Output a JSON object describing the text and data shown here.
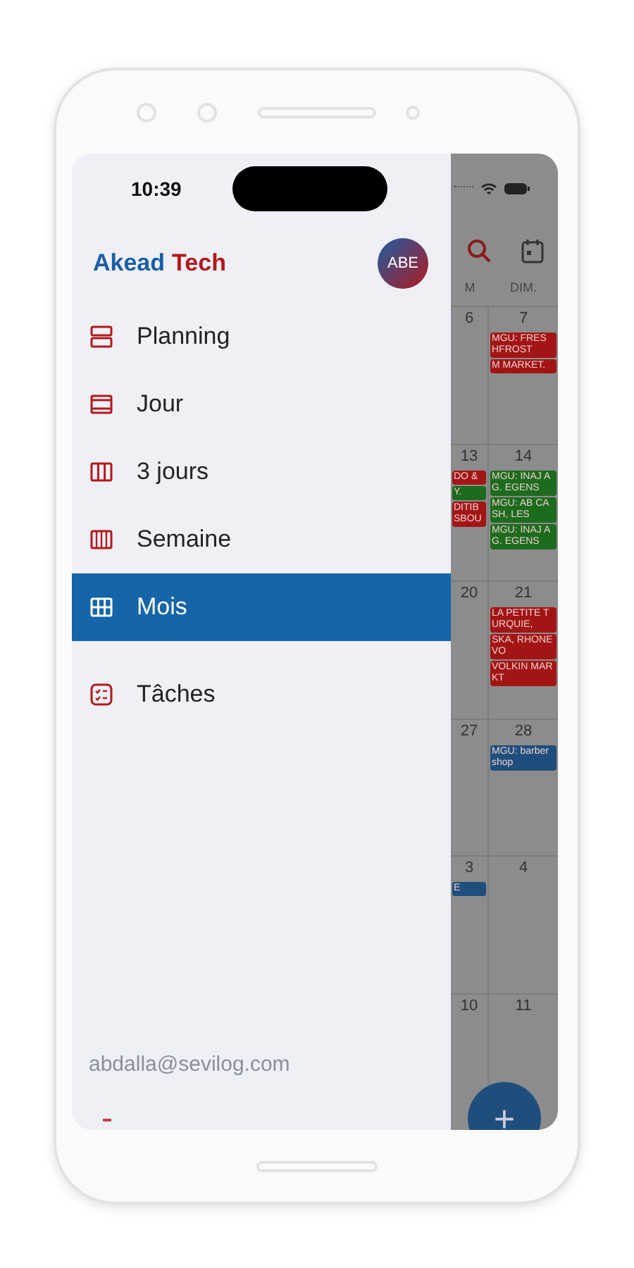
{
  "status_bar": {
    "time": "10:39"
  },
  "drawer": {
    "brand": [
      {
        "text": "Akead",
        "color": "#1b5ea6"
      },
      {
        "text": "Tech",
        "color": "#b3181d"
      }
    ],
    "avatar": "ABE",
    "items": [
      {
        "label": "Planning",
        "kind": "planning",
        "selected": false
      },
      {
        "label": "Jour",
        "kind": "day",
        "selected": false
      },
      {
        "label": "3 jours",
        "kind": "threedays",
        "selected": false
      },
      {
        "label": "Semaine",
        "kind": "week",
        "selected": false
      },
      {
        "label": "Mois",
        "kind": "month",
        "selected": true
      },
      {
        "label": "Tâches",
        "kind": "tasks",
        "selected": false
      }
    ],
    "email": "abdalla@sevilog.com"
  },
  "calendar": {
    "weekdays": [
      "M",
      "DIM."
    ],
    "weeks": [
      {
        "days": [
          {
            "date": "6"
          },
          {
            "date": "7",
            "events": [
              {
                "text": "MGU: FRES HFROST",
                "color": "#a31515"
              },
              {
                "text": "M MARKET.",
                "color": "#a31515"
              }
            ]
          }
        ]
      },
      {
        "days": [
          {
            "date": "13",
            "events": [
              {
                "text": "DO &",
                "color": "#a31515"
              },
              {
                "text": "Y.",
                "color": "#1d6b1d"
              },
              {
                "text": "DITIB SBOU",
                "color": "#a31515"
              }
            ]
          },
          {
            "date": "14",
            "events": [
              {
                "text": "MGU: INAJ AG. EGENS",
                "color": "#1d6b1d"
              },
              {
                "text": "MGU: AB CASH, LES",
                "color": "#1d6b1d"
              },
              {
                "text": "MGU: INAJ AG. EGENS",
                "color": "#1d6b1d"
              }
            ]
          }
        ]
      },
      {
        "days": [
          {
            "date": "20"
          },
          {
            "date": "21",
            "events": [
              {
                "text": "LA PETITE TURQUIE,",
                "color": "#a31515"
              },
              {
                "text": "SKA, RHONE VO",
                "color": "#a31515"
              },
              {
                "text": "VOLKIN MARKT",
                "color": "#a31515"
              }
            ]
          }
        ]
      },
      {
        "days": [
          {
            "date": "27"
          },
          {
            "date": "28",
            "events": [
              {
                "text": "MGU: barber shop",
                "color": "#1f4e7c"
              }
            ]
          }
        ]
      },
      {
        "days": [
          {
            "date": "3",
            "events": [
              {
                "text": "E",
                "color": "#1f4e7c"
              }
            ]
          },
          {
            "date": "4"
          }
        ]
      },
      {
        "days": [
          {
            "date": "10"
          },
          {
            "date": "11"
          }
        ]
      }
    ],
    "fab": "+"
  }
}
